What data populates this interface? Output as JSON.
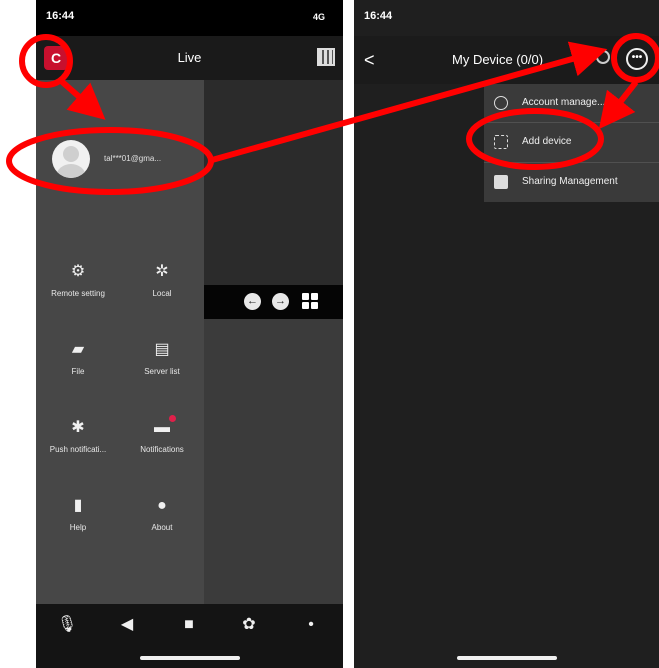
{
  "left_phone": {
    "status": {
      "time": "16:44",
      "signal": "4G"
    },
    "header": {
      "title": "Live",
      "logo_text": "C"
    },
    "profile": {
      "email": "tal***01@gma..."
    },
    "menu": [
      {
        "label": "Remote setting",
        "icon": "gear-icon"
      },
      {
        "label": "Local",
        "icon": "cog-icon"
      },
      {
        "label": "File",
        "icon": "folder-icon"
      },
      {
        "label": "Server list",
        "icon": "server-icon"
      },
      {
        "label": "Push notificati...",
        "icon": "push-gear-icon"
      },
      {
        "label": "Notifications",
        "icon": "notifications-icon"
      },
      {
        "label": "Help",
        "icon": "help-book-icon"
      },
      {
        "label": "About",
        "icon": "info-icon"
      }
    ],
    "video_controls": {
      "prev": "←",
      "next": "→"
    },
    "bottom_bar": [
      "microphone-icon",
      "speaker-icon",
      "grid-icon",
      "film-reel-icon",
      "more-icon"
    ]
  },
  "right_phone": {
    "status": {
      "time": "16:44"
    },
    "header": {
      "back": "<",
      "title": "My Device (0/0)",
      "more": "•••"
    },
    "dropdown": [
      {
        "label": "Account manage...",
        "icon": "account-icon"
      },
      {
        "label": "Add device",
        "icon": "scan-icon"
      },
      {
        "label": "Sharing Management",
        "icon": "share-icon"
      }
    ]
  },
  "colors": {
    "highlight": "#ff0000",
    "logo": "#c8102e",
    "badge": "#e0204a"
  }
}
